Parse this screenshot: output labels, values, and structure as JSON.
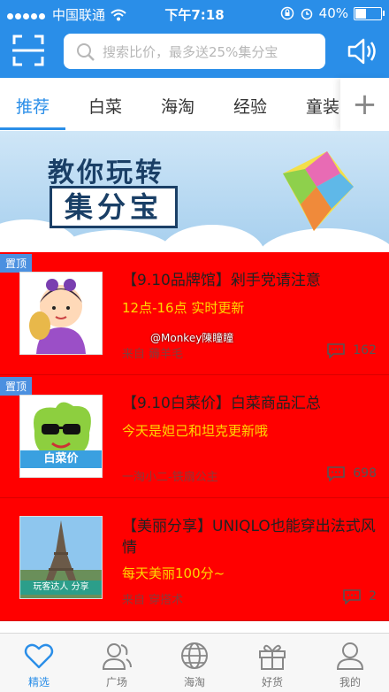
{
  "status_bar": {
    "carrier": "中国联通",
    "time": "下午7:18",
    "battery": "40%"
  },
  "header": {
    "search_placeholder": "搜索比价，最多送25%集分宝"
  },
  "tabs": [
    {
      "label": "推荐",
      "active": true
    },
    {
      "label": "白菜"
    },
    {
      "label": "海淘"
    },
    {
      "label": "经验"
    },
    {
      "label": "童装"
    }
  ],
  "banner": {
    "line1": "教你玩转",
    "line2": "集分宝"
  },
  "feed": [
    {
      "pinned": "置顶",
      "title": "【9.10品牌馆】剁手党请注意",
      "subtitle": "12点-16点 实时更新",
      "source": "来自 薅羊毛",
      "comments": "162"
    },
    {
      "pinned": "置顶",
      "title": "【9.10白菜价】白菜商品汇总",
      "subtitle": "今天是妲己和坦克更新哦",
      "source": "一淘小二-铁扇公主",
      "comments": "698",
      "thumb_tag": "白菜价"
    },
    {
      "title": "【美丽分享】UNIQLO也能穿出法式风情",
      "subtitle": "每天美丽100分~",
      "source": "来自 穿搭术",
      "comments": "2",
      "thumb_tag": "玩客达人 分享"
    }
  ],
  "watermark": "@Monkey陳瞳瞳",
  "bottom_nav": [
    {
      "label": "精选",
      "active": true
    },
    {
      "label": "广场"
    },
    {
      "label": "海淘"
    },
    {
      "label": "好货"
    },
    {
      "label": "我的"
    }
  ],
  "colors": {
    "primary": "#2a8ee8",
    "item_bg": "#ff0000",
    "subtitle": "#ffd800"
  }
}
